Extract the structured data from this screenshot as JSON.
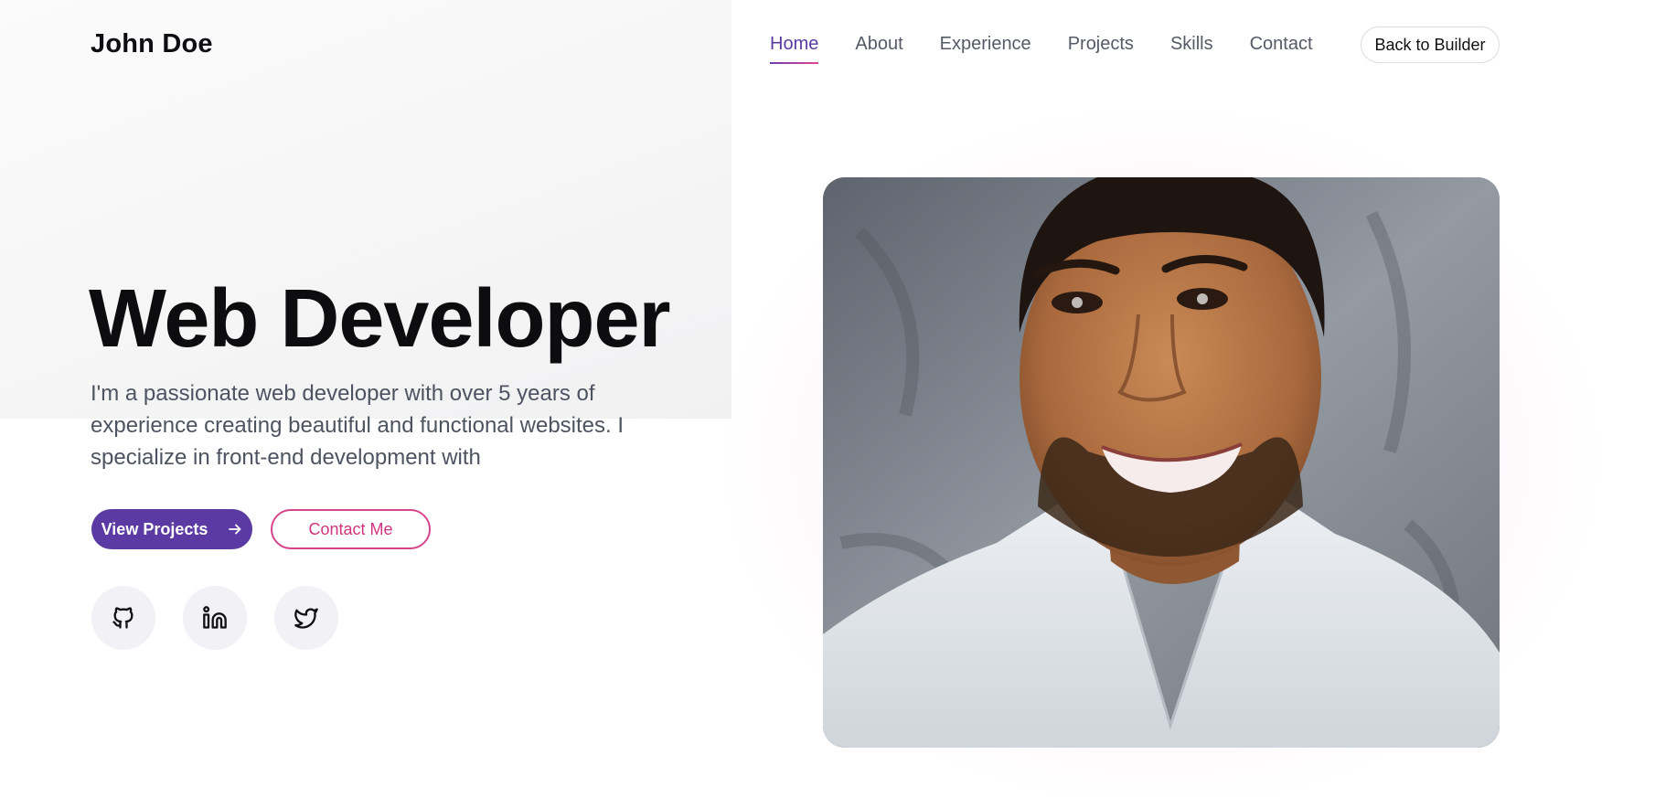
{
  "header": {
    "brand": "John Doe",
    "nav": [
      {
        "label": "Home",
        "active": true
      },
      {
        "label": "About",
        "active": false
      },
      {
        "label": "Experience",
        "active": false
      },
      {
        "label": "Projects",
        "active": false
      },
      {
        "label": "Skills",
        "active": false
      },
      {
        "label": "Contact",
        "active": false
      }
    ],
    "back_button": "Back to Builder"
  },
  "hero": {
    "title": "Web Developer",
    "description": "I'm a passionate web developer with over 5 years of experience creating beautiful and functional websites. I specialize in front-end development with",
    "primary_button": "View Projects",
    "primary_button_icon": "arrow-right-icon",
    "secondary_button": "Contact Me",
    "socials": [
      {
        "icon": "github-icon"
      },
      {
        "icon": "linkedin-icon"
      },
      {
        "icon": "twitter-icon"
      }
    ]
  },
  "colors": {
    "accent_purple": "#5b3aa3",
    "accent_pink": "#d6448a",
    "text_dark": "#0d0d0f",
    "text_muted": "#4e5361"
  }
}
